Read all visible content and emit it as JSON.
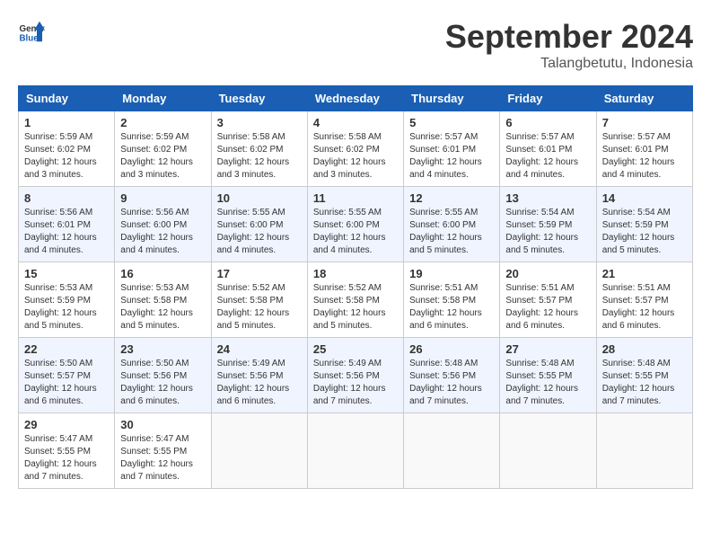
{
  "header": {
    "logo_line1": "General",
    "logo_line2": "Blue",
    "month": "September 2024",
    "location": "Talangbetutu, Indonesia"
  },
  "weekdays": [
    "Sunday",
    "Monday",
    "Tuesday",
    "Wednesday",
    "Thursday",
    "Friday",
    "Saturday"
  ],
  "weeks": [
    [
      {
        "day": "1",
        "info": "Sunrise: 5:59 AM\nSunset: 6:02 PM\nDaylight: 12 hours\nand 3 minutes."
      },
      {
        "day": "2",
        "info": "Sunrise: 5:59 AM\nSunset: 6:02 PM\nDaylight: 12 hours\nand 3 minutes."
      },
      {
        "day": "3",
        "info": "Sunrise: 5:58 AM\nSunset: 6:02 PM\nDaylight: 12 hours\nand 3 minutes."
      },
      {
        "day": "4",
        "info": "Sunrise: 5:58 AM\nSunset: 6:02 PM\nDaylight: 12 hours\nand 3 minutes."
      },
      {
        "day": "5",
        "info": "Sunrise: 5:57 AM\nSunset: 6:01 PM\nDaylight: 12 hours\nand 4 minutes."
      },
      {
        "day": "6",
        "info": "Sunrise: 5:57 AM\nSunset: 6:01 PM\nDaylight: 12 hours\nand 4 minutes."
      },
      {
        "day": "7",
        "info": "Sunrise: 5:57 AM\nSunset: 6:01 PM\nDaylight: 12 hours\nand 4 minutes."
      }
    ],
    [
      {
        "day": "8",
        "info": "Sunrise: 5:56 AM\nSunset: 6:01 PM\nDaylight: 12 hours\nand 4 minutes."
      },
      {
        "day": "9",
        "info": "Sunrise: 5:56 AM\nSunset: 6:00 PM\nDaylight: 12 hours\nand 4 minutes."
      },
      {
        "day": "10",
        "info": "Sunrise: 5:55 AM\nSunset: 6:00 PM\nDaylight: 12 hours\nand 4 minutes."
      },
      {
        "day": "11",
        "info": "Sunrise: 5:55 AM\nSunset: 6:00 PM\nDaylight: 12 hours\nand 4 minutes."
      },
      {
        "day": "12",
        "info": "Sunrise: 5:55 AM\nSunset: 6:00 PM\nDaylight: 12 hours\nand 5 minutes."
      },
      {
        "day": "13",
        "info": "Sunrise: 5:54 AM\nSunset: 5:59 PM\nDaylight: 12 hours\nand 5 minutes."
      },
      {
        "day": "14",
        "info": "Sunrise: 5:54 AM\nSunset: 5:59 PM\nDaylight: 12 hours\nand 5 minutes."
      }
    ],
    [
      {
        "day": "15",
        "info": "Sunrise: 5:53 AM\nSunset: 5:59 PM\nDaylight: 12 hours\nand 5 minutes."
      },
      {
        "day": "16",
        "info": "Sunrise: 5:53 AM\nSunset: 5:58 PM\nDaylight: 12 hours\nand 5 minutes."
      },
      {
        "day": "17",
        "info": "Sunrise: 5:52 AM\nSunset: 5:58 PM\nDaylight: 12 hours\nand 5 minutes."
      },
      {
        "day": "18",
        "info": "Sunrise: 5:52 AM\nSunset: 5:58 PM\nDaylight: 12 hours\nand 5 minutes."
      },
      {
        "day": "19",
        "info": "Sunrise: 5:51 AM\nSunset: 5:58 PM\nDaylight: 12 hours\nand 6 minutes."
      },
      {
        "day": "20",
        "info": "Sunrise: 5:51 AM\nSunset: 5:57 PM\nDaylight: 12 hours\nand 6 minutes."
      },
      {
        "day": "21",
        "info": "Sunrise: 5:51 AM\nSunset: 5:57 PM\nDaylight: 12 hours\nand 6 minutes."
      }
    ],
    [
      {
        "day": "22",
        "info": "Sunrise: 5:50 AM\nSunset: 5:57 PM\nDaylight: 12 hours\nand 6 minutes."
      },
      {
        "day": "23",
        "info": "Sunrise: 5:50 AM\nSunset: 5:56 PM\nDaylight: 12 hours\nand 6 minutes."
      },
      {
        "day": "24",
        "info": "Sunrise: 5:49 AM\nSunset: 5:56 PM\nDaylight: 12 hours\nand 6 minutes."
      },
      {
        "day": "25",
        "info": "Sunrise: 5:49 AM\nSunset: 5:56 PM\nDaylight: 12 hours\nand 7 minutes."
      },
      {
        "day": "26",
        "info": "Sunrise: 5:48 AM\nSunset: 5:56 PM\nDaylight: 12 hours\nand 7 minutes."
      },
      {
        "day": "27",
        "info": "Sunrise: 5:48 AM\nSunset: 5:55 PM\nDaylight: 12 hours\nand 7 minutes."
      },
      {
        "day": "28",
        "info": "Sunrise: 5:48 AM\nSunset: 5:55 PM\nDaylight: 12 hours\nand 7 minutes."
      }
    ],
    [
      {
        "day": "29",
        "info": "Sunrise: 5:47 AM\nSunset: 5:55 PM\nDaylight: 12 hours\nand 7 minutes."
      },
      {
        "day": "30",
        "info": "Sunrise: 5:47 AM\nSunset: 5:55 PM\nDaylight: 12 hours\nand 7 minutes."
      },
      {
        "day": "",
        "info": ""
      },
      {
        "day": "",
        "info": ""
      },
      {
        "day": "",
        "info": ""
      },
      {
        "day": "",
        "info": ""
      },
      {
        "day": "",
        "info": ""
      }
    ]
  ]
}
